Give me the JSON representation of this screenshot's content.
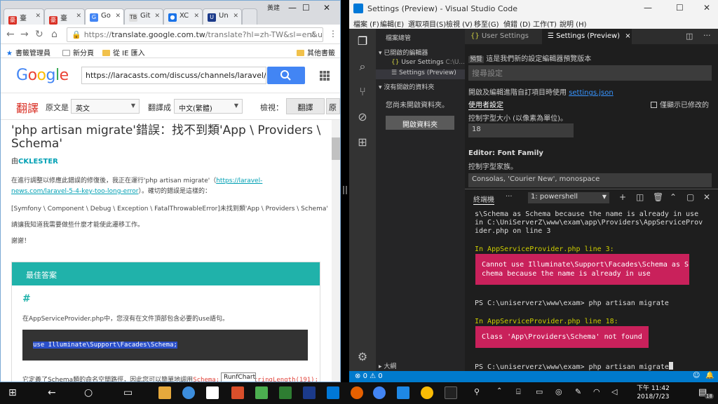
{
  "chrome": {
    "tabs": [
      {
        "icon": "豪",
        "label": "臺",
        "color": "#d93025"
      },
      {
        "icon": "豪",
        "label": "臺",
        "color": "#d93025"
      },
      {
        "icon": "G",
        "label": "Go",
        "color": "#4285f4"
      },
      {
        "icon": "TB",
        "label": "Git",
        "color": "#e0e0e0"
      },
      {
        "icon": "●",
        "label": "XC",
        "color": "#1a73e8"
      },
      {
        "icon": "U",
        "label": "Un",
        "color": "#1b3a8a"
      }
    ],
    "window_user": "黃建",
    "url_prefix": "https://",
    "url_host": "translate.google.com.tw",
    "url_rest": "/translate?hl=zh-TW&sl=en&u...",
    "bookmarks": [
      "書籤管理員",
      "新分頁",
      "從 IE 匯入",
      "其他書籤"
    ],
    "google_logo": "Google",
    "search_value": "https://laracasts.com/discuss/channels/laravel/php",
    "translate": {
      "brand": "翻譯",
      "source_label": "原文是",
      "source_value": "英文",
      "target_label": "翻譯成",
      "target_value": "中文(繁體)",
      "view_label": "檢視：",
      "view_btn": "翻譯",
      "view_btn2": "原"
    },
    "page": {
      "title": "'php artisan migrate'錯誤：找不到類'App \\ Providers \\ Schema'",
      "author_prefix": "由",
      "author": "CKLESTER",
      "para1a": "在進行調整以修應此錯誤的修復後，我正在運行'php artisan migrate'（",
      "para1_link": "https://laravel-news.com/laravel-5-4-key-too-long-error",
      "para1b": "）。確切的錯誤是這樣的：",
      "para2": "[Symfony \\ Component \\ Debug \\ Exception \\ FatalThrowableError]未找到類'App \\ Providers \\ Schema'",
      "para3": "請讓我知道我需要做些什麼才能使此遷移工作。",
      "para4": "謝謝！",
      "best_answer": "最佳答案",
      "hash": "#",
      "answer_text": "在AppServiceProvider.php中，您沒有在文件頂部包含必要的use語句。",
      "code": "use Illuminate\\Support\\Facades\\Schema;",
      "answer_text2a": "它定義了Schema類的命名空間路徑，因此您可以簡單地調用",
      "answer_text2b": "Schema::defaultStringLength(191);"
    },
    "tooltip": "RunfChart"
  },
  "vscode": {
    "title": "Settings (Preview) - Visual Studio Code",
    "menu": [
      "檔案 (F)",
      "編輯(E)",
      "選取項目(S)",
      "檢視 (V)",
      "移至(G)",
      "偵錯 (D)",
      "工作(T)",
      "說明 (H)"
    ],
    "sidebar": {
      "header": "檔案總管",
      "open_editors": "已開啟的編輯器",
      "file1": "User Settings",
      "file1_path": "C:\\U...",
      "file2": "Settings (Preview)",
      "no_folder": "沒有開啟的資料夾",
      "msg": "您尚未開啟資料夾。",
      "open_btn": "開啟資料夾",
      "outline": "大綱"
    },
    "tabs": [
      {
        "label": "User Settings"
      },
      {
        "label": "Settings (Preview)",
        "close": "×"
      }
    ],
    "settings": {
      "preview_badge": "預覽",
      "preview_text": "這是我們新的設定編輯器預覽版本",
      "search_placeholder": "搜尋設定",
      "desc": "開啟及編輯進階自訂項目時使用",
      "desc_link": "settings.json",
      "used_label": "使用者設定",
      "modified_label": "僅顯示已修改的",
      "fontsize_desc": "控制字型大小 (以像素為單位)。",
      "fontsize_value": "18",
      "fontfamily_title": "Editor: Font Family",
      "fontfamily_desc": "控制字型家族。",
      "fontfamily_value": "Consolas, 'Courier New', monospace"
    },
    "terminal": {
      "tab": "終端機",
      "more": "···",
      "shell": "1: powershell",
      "lines1": [
        "s\\Schema as Schema because the name is already in use",
        "in C:\\UniServerZ\\www\\exam\\app\\Providers\\AppServiceProv",
        "ider.php on line 3"
      ],
      "in_line3": "In AppServiceProvider.php line 3:",
      "err1": "Cannot use Illuminate\\Support\\Facades\\Schema as S\nchema because the name is already in use",
      "cmd1": "PS C:\\uniserverz\\www\\exam> php artisan migrate",
      "in_line18": "In AppServiceProvider.php line 18:",
      "err2": "Class 'App\\Providers\\Schema' not found",
      "cmd2": "PS C:\\uniserverz\\www\\exam> php artisan migrate"
    },
    "status": {
      "errors": "0",
      "warnings": "0",
      "notif": "🔔"
    }
  },
  "taskbar": {
    "time": "下午 11:42",
    "date": "2018/7/23",
    "notif_count": "18"
  }
}
